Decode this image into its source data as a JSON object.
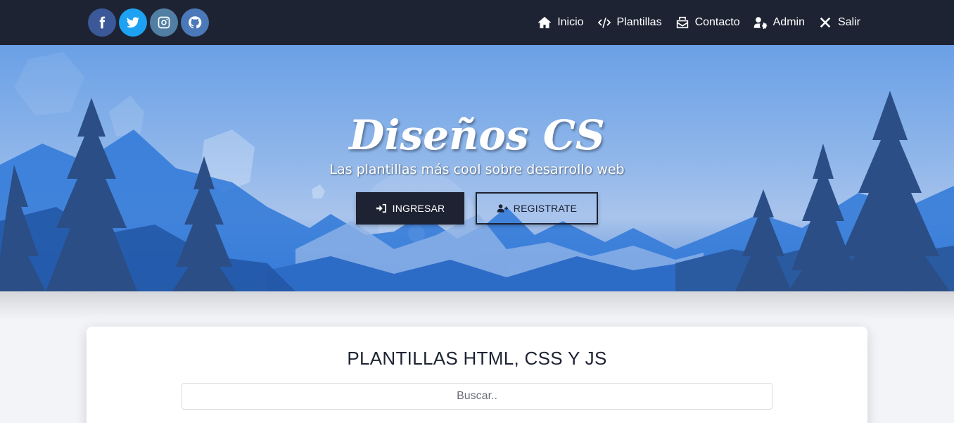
{
  "colors": {
    "navbar": "#1e2333",
    "facebook": "#3b5998",
    "twitter": "#1da1f2",
    "instagram": "#517fa4",
    "github": "#4a78b8"
  },
  "socials": [
    {
      "name": "facebook",
      "icon": "facebook-icon"
    },
    {
      "name": "twitter",
      "icon": "twitter-icon"
    },
    {
      "name": "instagram",
      "icon": "instagram-icon"
    },
    {
      "name": "github",
      "icon": "github-icon"
    }
  ],
  "nav": {
    "items": [
      {
        "label": "Inicio",
        "icon": "home-icon"
      },
      {
        "label": "Plantillas",
        "icon": "code-icon"
      },
      {
        "label": "Contacto",
        "icon": "mail-bulk-icon"
      },
      {
        "label": "Admin",
        "icon": "user-cog-icon"
      },
      {
        "label": "Salir",
        "icon": "times-icon"
      }
    ]
  },
  "hero": {
    "title": "Diseños CS",
    "subtitle": "Las plantillas más cool sobre desarrollo web",
    "login_label": "INGRESAR",
    "register_label": "REGISTRATE"
  },
  "main": {
    "title": "PLANTILLAS HTML, CSS Y JS",
    "search_placeholder": "Buscar.."
  }
}
